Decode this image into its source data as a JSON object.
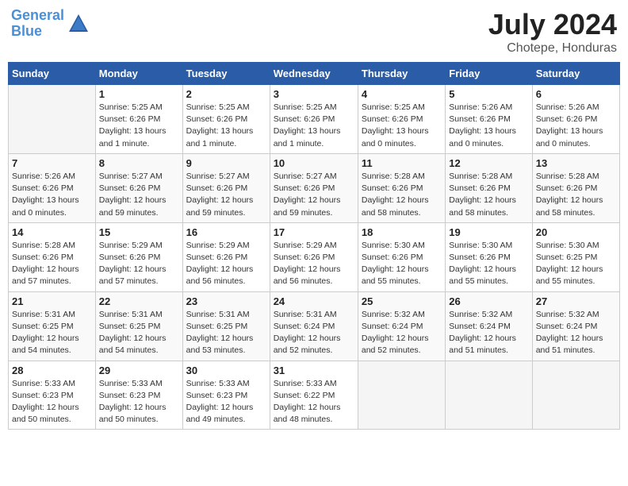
{
  "header": {
    "logo_line1": "General",
    "logo_line2": "Blue",
    "month_year": "July 2024",
    "location": "Chotepe, Honduras"
  },
  "days_of_week": [
    "Sunday",
    "Monday",
    "Tuesday",
    "Wednesday",
    "Thursday",
    "Friday",
    "Saturday"
  ],
  "weeks": [
    [
      {
        "day": "",
        "info": ""
      },
      {
        "day": "1",
        "info": "Sunrise: 5:25 AM\nSunset: 6:26 PM\nDaylight: 13 hours\nand 1 minute."
      },
      {
        "day": "2",
        "info": "Sunrise: 5:25 AM\nSunset: 6:26 PM\nDaylight: 13 hours\nand 1 minute."
      },
      {
        "day": "3",
        "info": "Sunrise: 5:25 AM\nSunset: 6:26 PM\nDaylight: 13 hours\nand 1 minute."
      },
      {
        "day": "4",
        "info": "Sunrise: 5:25 AM\nSunset: 6:26 PM\nDaylight: 13 hours\nand 0 minutes."
      },
      {
        "day": "5",
        "info": "Sunrise: 5:26 AM\nSunset: 6:26 PM\nDaylight: 13 hours\nand 0 minutes."
      },
      {
        "day": "6",
        "info": "Sunrise: 5:26 AM\nSunset: 6:26 PM\nDaylight: 13 hours\nand 0 minutes."
      }
    ],
    [
      {
        "day": "7",
        "info": "Sunrise: 5:26 AM\nSunset: 6:26 PM\nDaylight: 13 hours\nand 0 minutes."
      },
      {
        "day": "8",
        "info": "Sunrise: 5:27 AM\nSunset: 6:26 PM\nDaylight: 12 hours\nand 59 minutes."
      },
      {
        "day": "9",
        "info": "Sunrise: 5:27 AM\nSunset: 6:26 PM\nDaylight: 12 hours\nand 59 minutes."
      },
      {
        "day": "10",
        "info": "Sunrise: 5:27 AM\nSunset: 6:26 PM\nDaylight: 12 hours\nand 59 minutes."
      },
      {
        "day": "11",
        "info": "Sunrise: 5:28 AM\nSunset: 6:26 PM\nDaylight: 12 hours\nand 58 minutes."
      },
      {
        "day": "12",
        "info": "Sunrise: 5:28 AM\nSunset: 6:26 PM\nDaylight: 12 hours\nand 58 minutes."
      },
      {
        "day": "13",
        "info": "Sunrise: 5:28 AM\nSunset: 6:26 PM\nDaylight: 12 hours\nand 58 minutes."
      }
    ],
    [
      {
        "day": "14",
        "info": "Sunrise: 5:28 AM\nSunset: 6:26 PM\nDaylight: 12 hours\nand 57 minutes."
      },
      {
        "day": "15",
        "info": "Sunrise: 5:29 AM\nSunset: 6:26 PM\nDaylight: 12 hours\nand 57 minutes."
      },
      {
        "day": "16",
        "info": "Sunrise: 5:29 AM\nSunset: 6:26 PM\nDaylight: 12 hours\nand 56 minutes."
      },
      {
        "day": "17",
        "info": "Sunrise: 5:29 AM\nSunset: 6:26 PM\nDaylight: 12 hours\nand 56 minutes."
      },
      {
        "day": "18",
        "info": "Sunrise: 5:30 AM\nSunset: 6:26 PM\nDaylight: 12 hours\nand 55 minutes."
      },
      {
        "day": "19",
        "info": "Sunrise: 5:30 AM\nSunset: 6:26 PM\nDaylight: 12 hours\nand 55 minutes."
      },
      {
        "day": "20",
        "info": "Sunrise: 5:30 AM\nSunset: 6:25 PM\nDaylight: 12 hours\nand 55 minutes."
      }
    ],
    [
      {
        "day": "21",
        "info": "Sunrise: 5:31 AM\nSunset: 6:25 PM\nDaylight: 12 hours\nand 54 minutes."
      },
      {
        "day": "22",
        "info": "Sunrise: 5:31 AM\nSunset: 6:25 PM\nDaylight: 12 hours\nand 54 minutes."
      },
      {
        "day": "23",
        "info": "Sunrise: 5:31 AM\nSunset: 6:25 PM\nDaylight: 12 hours\nand 53 minutes."
      },
      {
        "day": "24",
        "info": "Sunrise: 5:31 AM\nSunset: 6:24 PM\nDaylight: 12 hours\nand 52 minutes."
      },
      {
        "day": "25",
        "info": "Sunrise: 5:32 AM\nSunset: 6:24 PM\nDaylight: 12 hours\nand 52 minutes."
      },
      {
        "day": "26",
        "info": "Sunrise: 5:32 AM\nSunset: 6:24 PM\nDaylight: 12 hours\nand 51 minutes."
      },
      {
        "day": "27",
        "info": "Sunrise: 5:32 AM\nSunset: 6:24 PM\nDaylight: 12 hours\nand 51 minutes."
      }
    ],
    [
      {
        "day": "28",
        "info": "Sunrise: 5:33 AM\nSunset: 6:23 PM\nDaylight: 12 hours\nand 50 minutes."
      },
      {
        "day": "29",
        "info": "Sunrise: 5:33 AM\nSunset: 6:23 PM\nDaylight: 12 hours\nand 50 minutes."
      },
      {
        "day": "30",
        "info": "Sunrise: 5:33 AM\nSunset: 6:23 PM\nDaylight: 12 hours\nand 49 minutes."
      },
      {
        "day": "31",
        "info": "Sunrise: 5:33 AM\nSunset: 6:22 PM\nDaylight: 12 hours\nand 48 minutes."
      },
      {
        "day": "",
        "info": ""
      },
      {
        "day": "",
        "info": ""
      },
      {
        "day": "",
        "info": ""
      }
    ]
  ]
}
